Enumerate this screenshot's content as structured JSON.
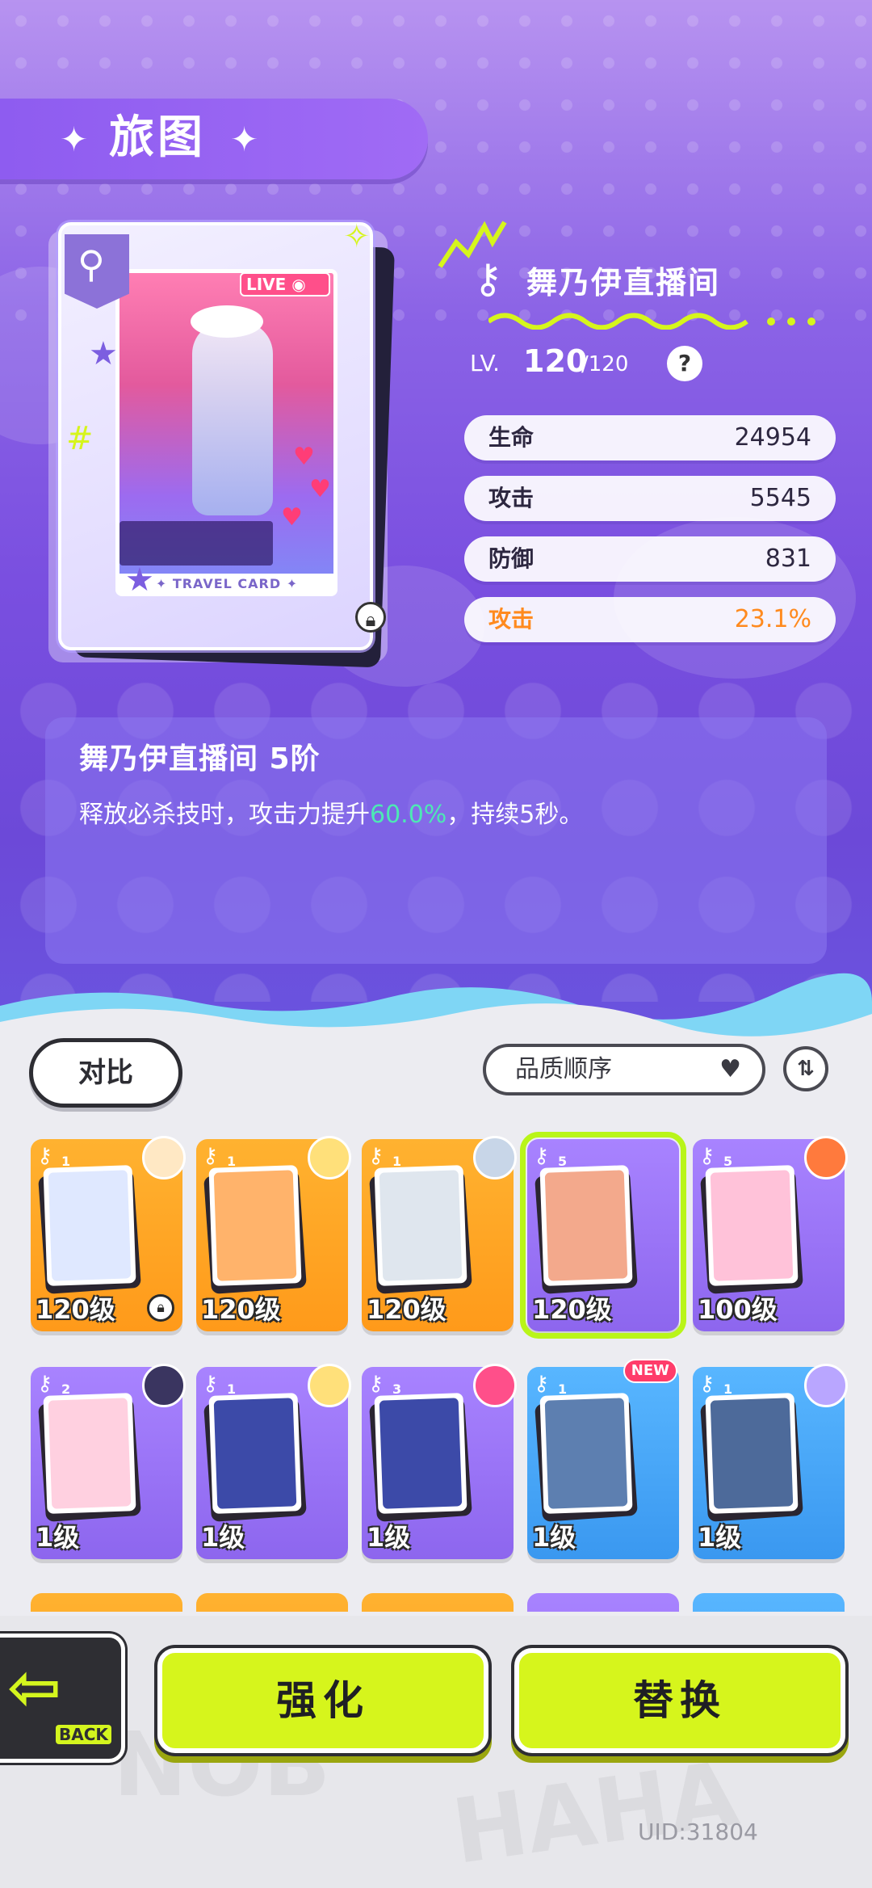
{
  "header": {
    "title": "旅图"
  },
  "card": {
    "name": "舞乃伊直播间",
    "level_prefix": "LV.",
    "level": "120",
    "level_max": "/120",
    "live_label": "LIVE",
    "card_label": "✦ TRAVEL CARD ✦"
  },
  "stats": [
    {
      "label": "生命",
      "value": "24954"
    },
    {
      "label": "攻击",
      "value": "5545"
    },
    {
      "label": "防御",
      "value": "831"
    },
    {
      "label": "攻击",
      "value": "23.1%"
    }
  ],
  "skill": {
    "title": "舞乃伊直播间 5阶",
    "desc_before": "释放必杀技时，攻击力提升",
    "desc_highlight": "60.0%",
    "desc_after": "，持续5秒。"
  },
  "controls": {
    "compare_label": "对比",
    "sort_label": "品质顺序"
  },
  "grid": {
    "row1": [
      {
        "level": "120级",
        "rank": "1",
        "color": "orange",
        "art": "#dfe8ff",
        "avatar": "#ffe8c4",
        "locked": true
      },
      {
        "level": "120级",
        "rank": "1",
        "color": "orange",
        "art": "#ffb36b",
        "avatar": "#ffe07a"
      },
      {
        "level": "120级",
        "rank": "1",
        "color": "orange",
        "art": "#dfe6ee",
        "avatar": "#c8d6e8"
      },
      {
        "level": "120级",
        "rank": "5",
        "color": "purple",
        "art": "#f3a98c",
        "avatar": "",
        "selected": true
      },
      {
        "level": "100级",
        "rank": "5",
        "color": "purple",
        "art": "#ffc2d9",
        "avatar": "#ff7a3d"
      }
    ],
    "row2": [
      {
        "level": "1级",
        "rank": "2",
        "color": "purple",
        "art": "#ffd0e0",
        "avatar": "#3a3560"
      },
      {
        "level": "1级",
        "rank": "1",
        "color": "purple",
        "art": "#3c4aa8",
        "avatar": "#ffe07a"
      },
      {
        "level": "1级",
        "rank": "3",
        "color": "purple",
        "art": "#3c4aa8",
        "avatar": "#ff4f8a"
      },
      {
        "level": "1级",
        "rank": "1",
        "color": "blue",
        "art": "#5d7fb0",
        "avatar": "",
        "new": "NEW"
      },
      {
        "level": "1级",
        "rank": "1",
        "color": "blue",
        "art": "#4d6a9a",
        "avatar": "#b9a6ff"
      }
    ],
    "row3_colors": [
      "orange",
      "orange",
      "orange",
      "purple",
      "blue"
    ]
  },
  "bottom": {
    "back_label": "BACK",
    "enhance_label": "强化",
    "replace_label": "替换",
    "uid": "UID:31804"
  }
}
